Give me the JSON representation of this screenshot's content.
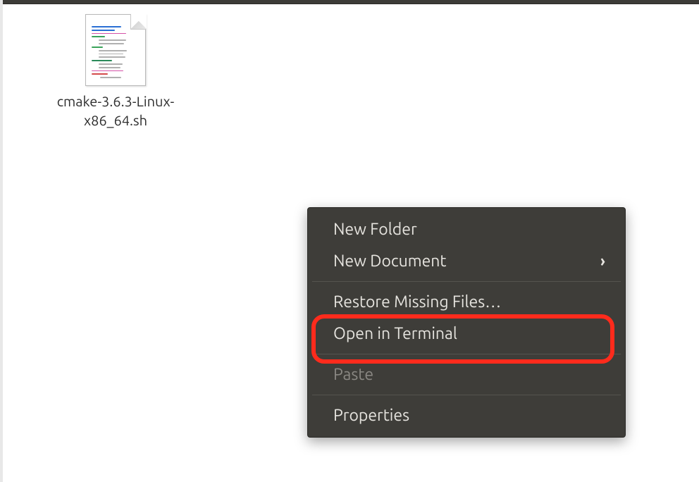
{
  "file": {
    "name": "cmake-3.6.3-Linux-x86_64.sh"
  },
  "context_menu": {
    "items": [
      {
        "label": "New Folder",
        "enabled": true,
        "submenu": false
      },
      {
        "label": "New Document",
        "enabled": true,
        "submenu": true
      },
      {
        "sep": true
      },
      {
        "label": "Restore Missing Files…",
        "enabled": true,
        "submenu": false
      },
      {
        "label": "Open in Terminal",
        "enabled": true,
        "submenu": false,
        "highlighted": true
      },
      {
        "sep": true
      },
      {
        "label": "Paste",
        "enabled": false,
        "submenu": false
      },
      {
        "sep": true
      },
      {
        "label": "Properties",
        "enabled": true,
        "submenu": false
      }
    ]
  }
}
